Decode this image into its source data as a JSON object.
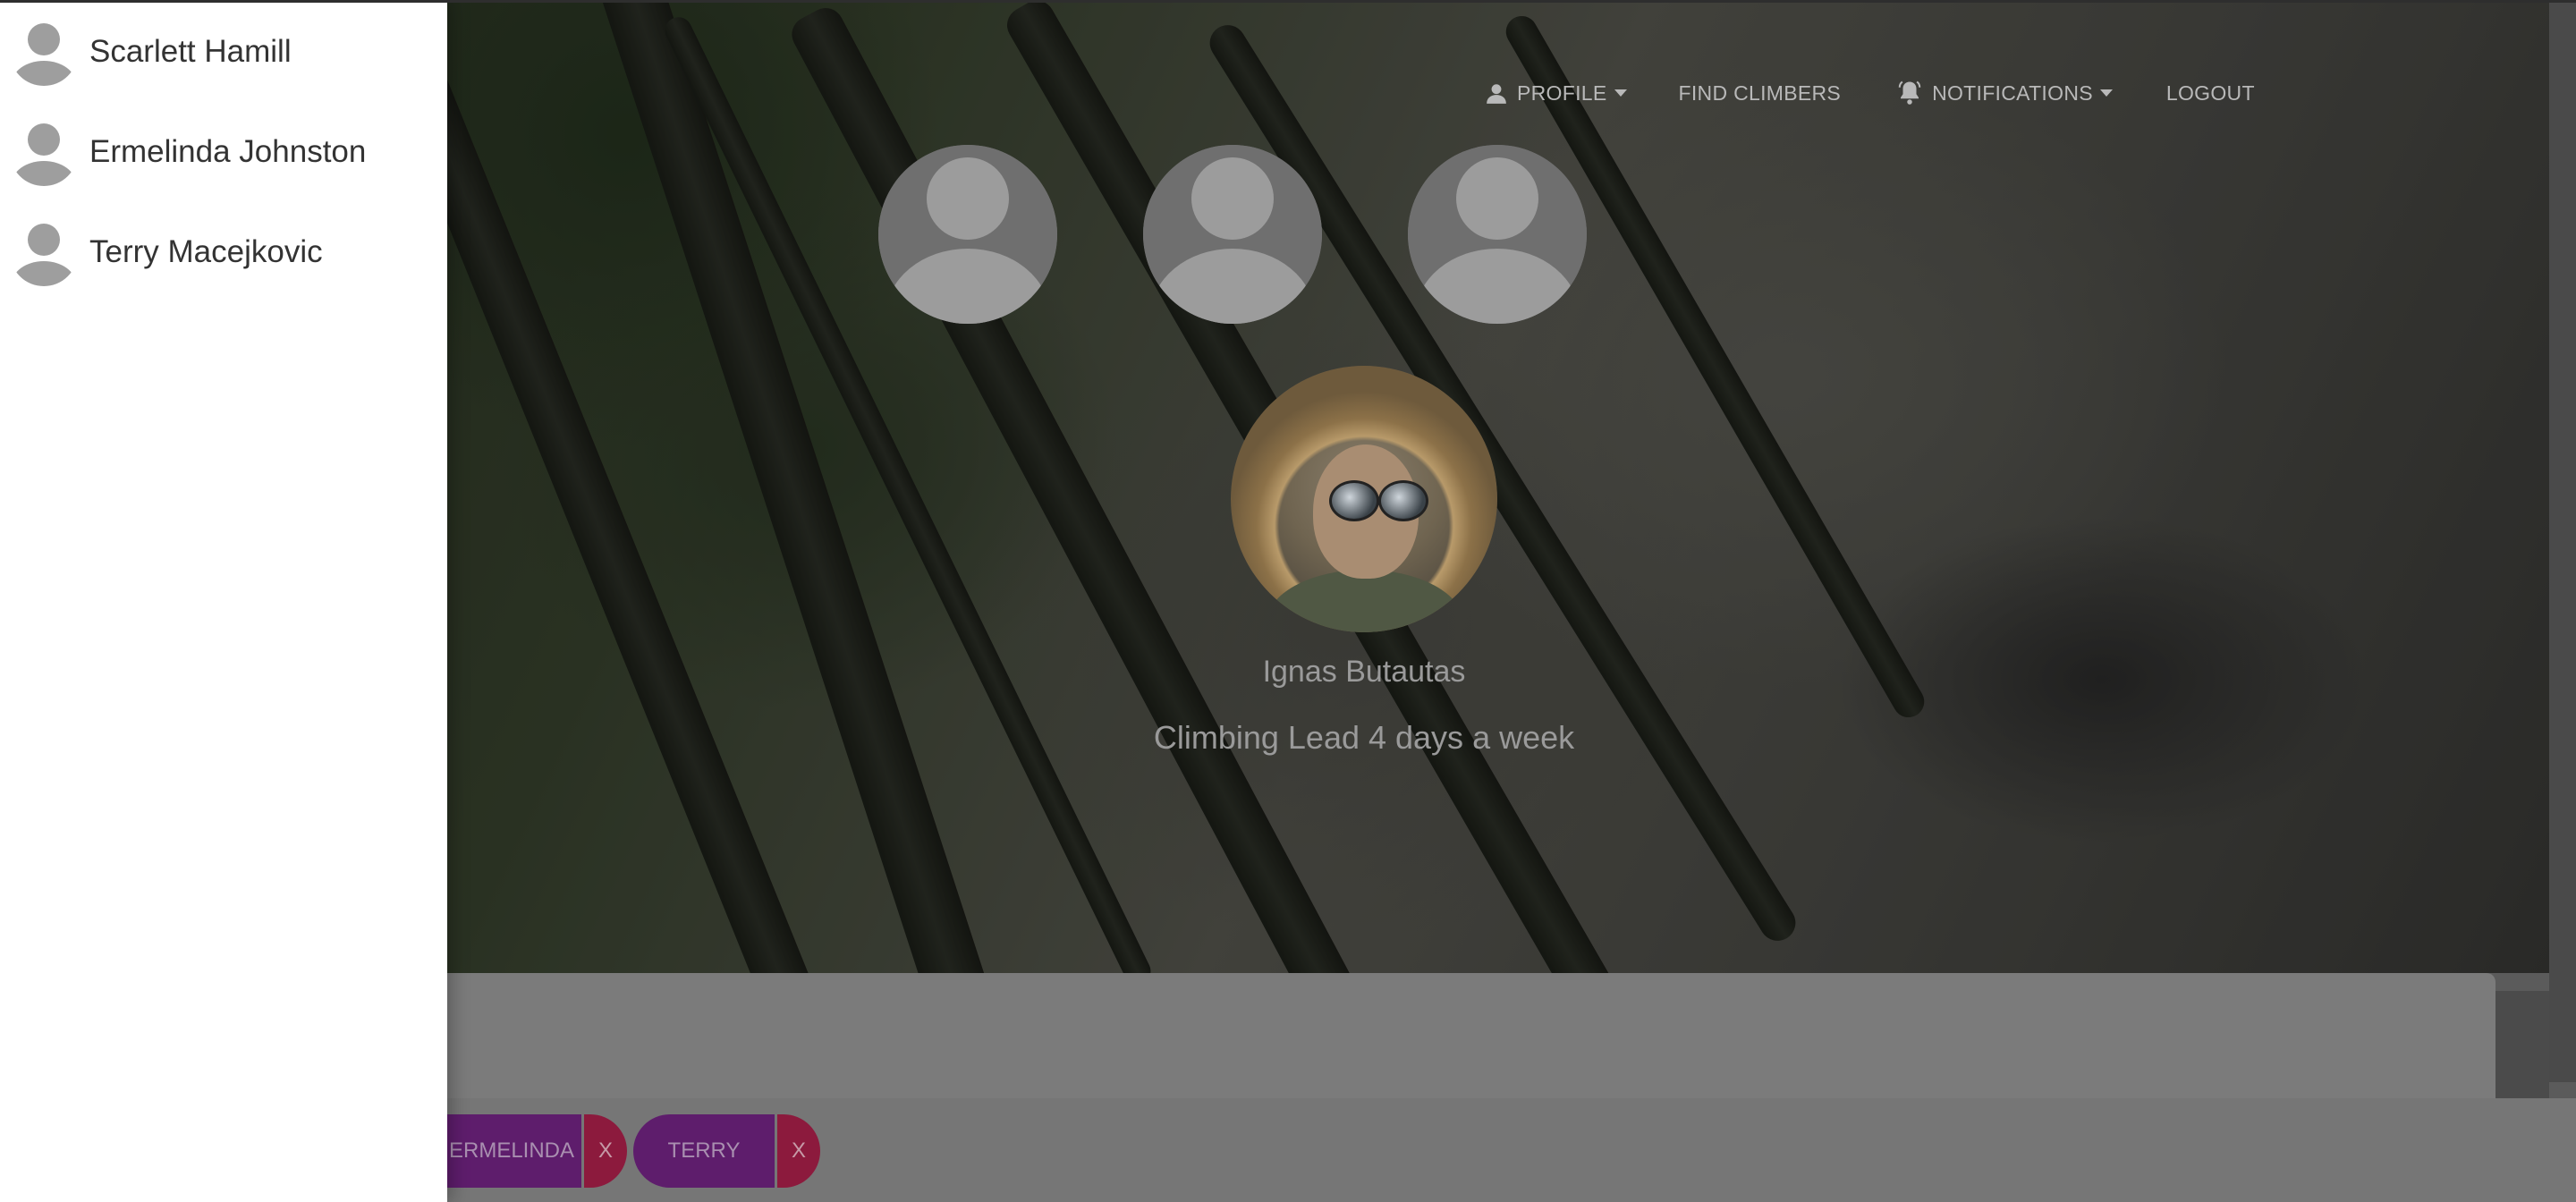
{
  "nav": {
    "profile": "PROFILE",
    "find_climbers": "FIND CLIMBERS",
    "notifications": "NOTIFICATIONS",
    "logout": "LOGOUT"
  },
  "sidebar": {
    "friends": [
      {
        "name": "Scarlett Hamill"
      },
      {
        "name": "Ermelinda Johnston"
      },
      {
        "name": "Terry Macejkovic"
      }
    ]
  },
  "profile": {
    "name": "Ignas Butautas",
    "tagline": "Climbing Lead 4 days a week"
  },
  "chat_tabs": [
    {
      "label": "ERMELINDA",
      "close": "X"
    },
    {
      "label": "TERRY",
      "close": "X"
    }
  ]
}
